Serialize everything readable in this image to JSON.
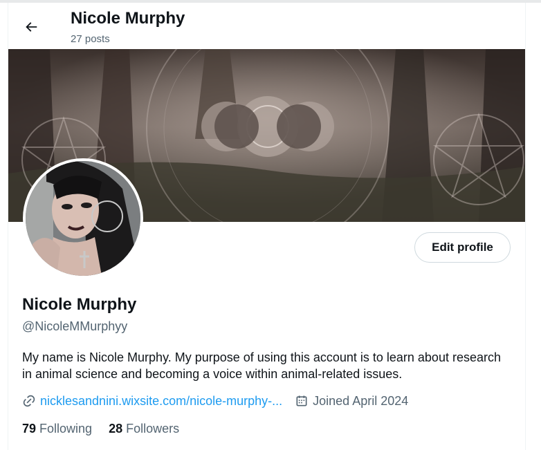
{
  "header": {
    "title": "Nicole Murphy",
    "post_count": "27 posts"
  },
  "banner": {
    "description_icon": "forest-moon-banner"
  },
  "profile": {
    "display_name": "Nicole Murphy",
    "handle": "@NicoleMMurphyy",
    "bio": "My name is Nicole Murphy.  My purpose of using this account is to learn about research in animal science and becoming a voice within animal-related issues.",
    "website": "nicklesandnini.wixsite.com/nicole-murphy-...",
    "joined": "Joined April 2024",
    "edit_button_label": "Edit profile"
  },
  "stats": {
    "following_count": "79",
    "following_label": "Following",
    "followers_count": "28",
    "followers_label": "Followers"
  },
  "colors": {
    "text": "#0f1419",
    "secondary": "#536471",
    "link": "#1d9bf0",
    "border": "#cfd9de"
  },
  "icons": {
    "back": "arrow-left-icon",
    "link": "link-icon",
    "calendar": "calendar-icon"
  }
}
